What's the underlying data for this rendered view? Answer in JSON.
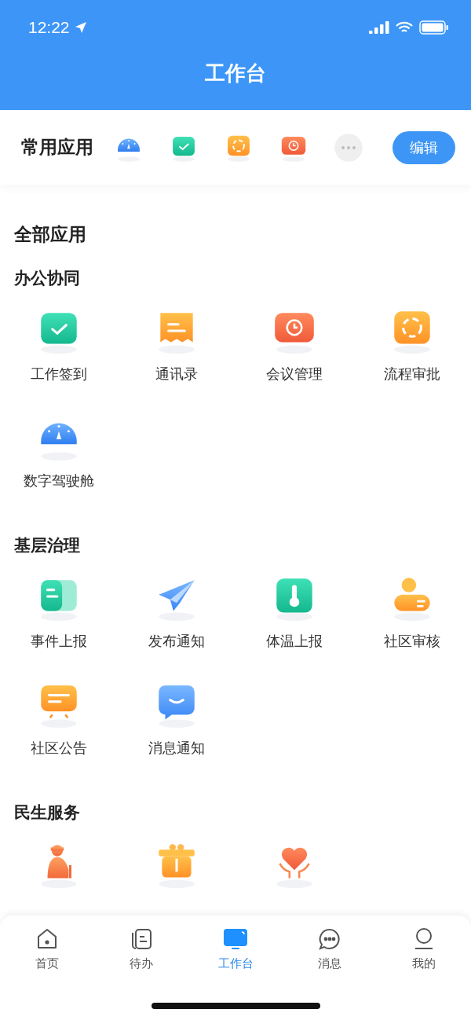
{
  "status_bar": {
    "time": "12:22"
  },
  "header": {
    "title": "工作台"
  },
  "favorites": {
    "title": "常用应用",
    "apps": [
      {
        "kind": "gauge"
      },
      {
        "kind": "check"
      },
      {
        "kind": "flow"
      },
      {
        "kind": "meeting"
      },
      {
        "kind": "more"
      }
    ],
    "edit_button": "编辑"
  },
  "all_apps": {
    "title": "全部应用",
    "sections": [
      {
        "title": "办公协同",
        "apps": [
          {
            "kind": "check",
            "label": "工作签到"
          },
          {
            "kind": "contacts",
            "label": "通讯录"
          },
          {
            "kind": "meeting",
            "label": "会议管理"
          },
          {
            "kind": "flow",
            "label": "流程审批"
          },
          {
            "kind": "gauge",
            "label": "数字驾驶舱"
          }
        ]
      },
      {
        "title": "基层治理",
        "apps": [
          {
            "kind": "book",
            "label": "事件上报"
          },
          {
            "kind": "plane",
            "label": "发布通知"
          },
          {
            "kind": "thermo",
            "label": "体温上报"
          },
          {
            "kind": "person",
            "label": "社区审核"
          },
          {
            "kind": "notice",
            "label": "社区公告"
          },
          {
            "kind": "chat",
            "label": "消息通知"
          }
        ]
      },
      {
        "title": "民生服务",
        "apps": [
          {
            "kind": "elder"
          },
          {
            "kind": "gift"
          },
          {
            "kind": "heart"
          }
        ]
      }
    ]
  },
  "tab_bar": [
    {
      "kind": "home",
      "label": "首页",
      "selected": false
    },
    {
      "kind": "todo",
      "label": "待办",
      "selected": false
    },
    {
      "kind": "desk",
      "label": "工作台",
      "selected": true
    },
    {
      "kind": "message",
      "label": "消息",
      "selected": false
    },
    {
      "kind": "user",
      "label": "我的",
      "selected": false
    }
  ]
}
